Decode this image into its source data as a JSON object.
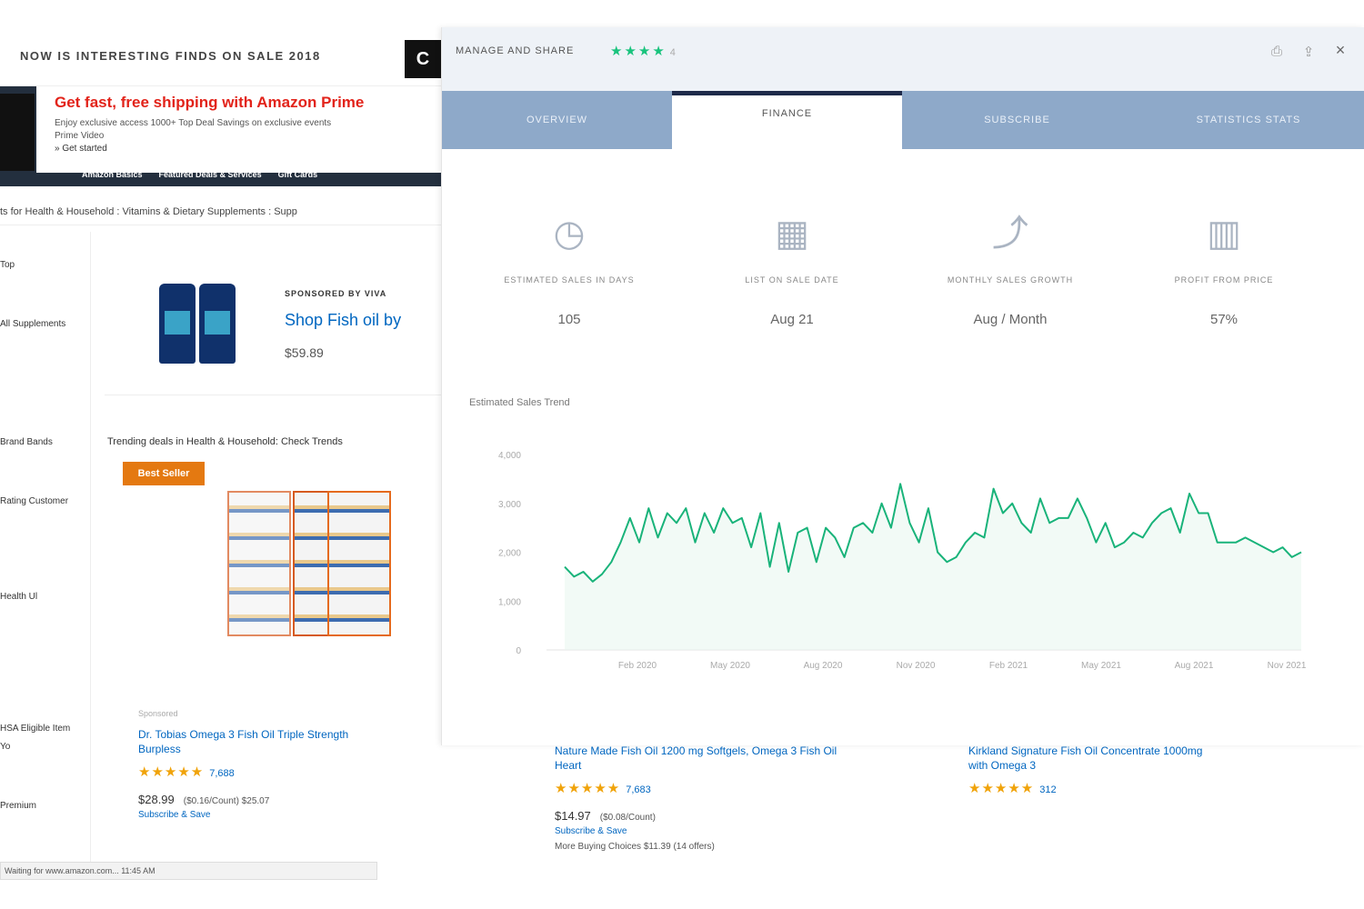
{
  "background_page": {
    "promo_text": "NOW IS INTERESTING FINDS ON SALE 2018",
    "logo_glyph": "C",
    "prime_headline": "Get fast, free shipping with Amazon Prime",
    "prime_sub": "Enjoy exclusive access 1000+ Top Deal Savings on exclusive events",
    "prime_sub2": "Prime Video",
    "prime_link": "» Get started",
    "prime_nav": [
      "Amazon Basics",
      "Featured Deals & Services",
      "Gift Cards"
    ],
    "breadcrumb": "ts for Health & Household : Vitamins & Dietary Supplements : Supp",
    "rail": [
      "Top",
      "All Supplements",
      "Brand Bands",
      "Rating Customer",
      "Health Ul",
      "HSA Eligible Item",
      "Yo",
      "Premium"
    ],
    "sponsor_label": "SPONSORED BY VIVA",
    "sponsor_title": "Shop Fish oil by",
    "sponsor_price": "$59.89",
    "trending_label": "Trending deals in Health & Household: Check Trends",
    "deal_badge": "Best Seller",
    "status_bar": "Waiting for www.amazon.com... 11:45 AM"
  },
  "products": [
    {
      "topline": "Sponsored",
      "title": "Dr. Tobias Omega 3 Fish Oil Triple Strength",
      "title2": "Burpless",
      "stars": "★★★★★",
      "reviews": "7,688",
      "price": "$28.99",
      "price_note": "($0.16/Count) $25.07",
      "sub": "Subscribe & Save",
      "note": ""
    },
    {
      "topline": "",
      "title": "Nature Made Fish Oil 1200 mg Softgels, Omega 3 Fish Oil",
      "title2": "Heart",
      "stars": "★★★★★",
      "reviews": "7,683",
      "price": "$14.97",
      "price_note": "($0.08/Count)",
      "sub": "Subscribe & Save",
      "note": "More Buying Choices $11.39 (14 offers)"
    },
    {
      "topline": "",
      "title": "Kirkland Signature Fish Oil Concentrate 1000mg",
      "title2": "with Omega 3",
      "stars": "★★★★★",
      "reviews": "312",
      "price": "",
      "price_note": "",
      "sub": "",
      "note": ""
    }
  ],
  "panel": {
    "header_title": "MANAGE AND SHARE",
    "stars": "★★★★",
    "stars_count": "4",
    "icons": [
      "print-icon",
      "share-icon",
      "close-icon"
    ],
    "close_glyph": "×",
    "print_glyph": "⎙",
    "share_glyph": "⇪",
    "tabs": [
      "OVERVIEW",
      "FINANCE",
      "SUBSCRIBE",
      "STATISTICS STATS"
    ],
    "active_tab": 1,
    "stats": [
      {
        "icon": "clock-icon",
        "glyph": "◷",
        "label": "ESTIMATED SALES IN DAYS",
        "value": "105"
      },
      {
        "icon": "calendar-icon",
        "glyph": "▦",
        "label": "LIST ON SALE DATE",
        "value": "Aug 21"
      },
      {
        "icon": "trend-icon",
        "glyph": "⤴",
        "label": "MONTHLY SALES GROWTH",
        "value": "Aug / Month"
      },
      {
        "icon": "bar-chart-icon",
        "glyph": "▥",
        "label": "PROFIT FROM PRICE",
        "value": "57%"
      }
    ],
    "chart_title": "Estimated Sales Trend",
    "line_color": "#19b37a"
  },
  "chart_data": {
    "type": "line",
    "title": "Estimated Sales Trend",
    "xlabel": "",
    "ylabel": "",
    "ylim": [
      0,
      4000
    ],
    "yticks": [
      "0",
      "1,000",
      "2,000",
      "3,000",
      "4,000"
    ],
    "xticks": [
      "Feb 2020",
      "May 2020",
      "Aug 2020",
      "Nov 2020",
      "Feb 2021",
      "May 2021",
      "Aug 2021",
      "Nov 2021"
    ],
    "series": [
      {
        "values": [
          1700,
          1500,
          1600,
          1400,
          1550,
          1800,
          2200,
          2700,
          2200,
          2900,
          2300,
          2800,
          2600,
          2900,
          2200,
          2800,
          2400,
          2900,
          2600,
          2700,
          2100,
          2800,
          1700,
          2600,
          1600,
          2400,
          2500,
          1800,
          2500,
          2300,
          1900,
          2500,
          2600,
          2400,
          3000,
          2500,
          3400,
          2600,
          2200,
          2900,
          2000,
          1800,
          1900,
          2200,
          2400,
          2300,
          3300,
          2800,
          3000,
          2600,
          2400,
          3100,
          2600,
          2700,
          2700,
          3100,
          2700,
          2200,
          2600,
          2100,
          2200,
          2400,
          2300,
          2600,
          2800,
          2900,
          2400,
          3200,
          2800,
          2800,
          2200,
          2200,
          2200,
          2300,
          2200,
          2100,
          2000,
          2100,
          1900,
          2000
        ]
      }
    ],
    "grid": false,
    "legend": "none"
  }
}
